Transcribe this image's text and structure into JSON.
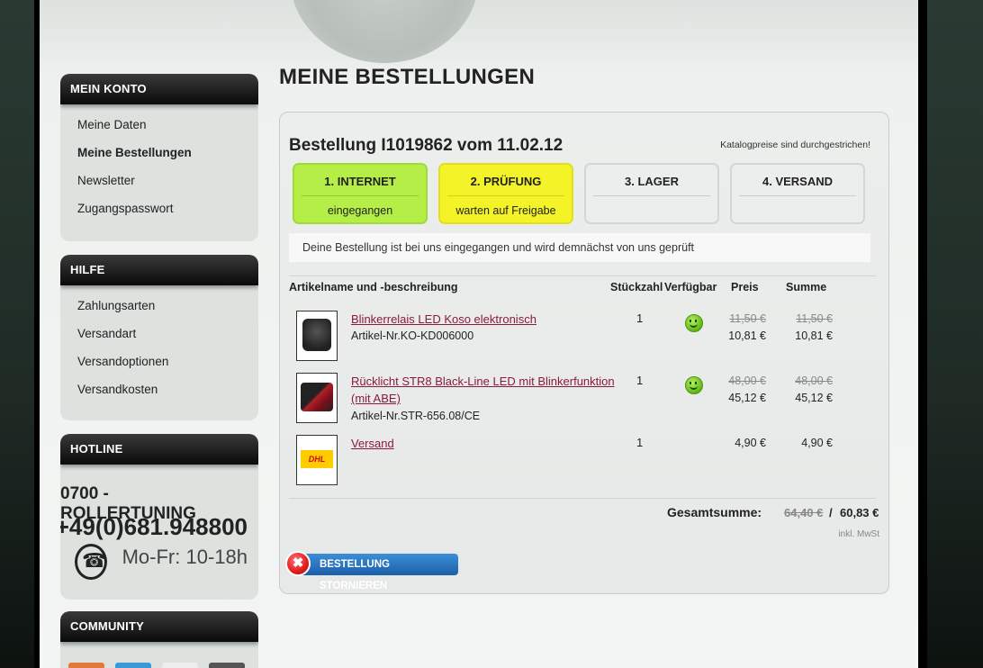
{
  "sidebar": {
    "mein_konto": {
      "title": "MEIN KONTO",
      "items": [
        {
          "label": "Meine Daten",
          "active": false
        },
        {
          "label": "Meine Bestellungen",
          "active": true
        },
        {
          "label": "Newsletter",
          "active": false
        },
        {
          "label": "Zugangspasswort",
          "active": false
        }
      ]
    },
    "hilfe": {
      "title": "HILFE",
      "items": [
        {
          "label": "Zahlungsarten"
        },
        {
          "label": "Versandart"
        },
        {
          "label": "Versandoptionen"
        },
        {
          "label": "Versandkosten"
        }
      ]
    },
    "hotline": {
      "title": "HOTLINE",
      "name": "0700 - ROLLERTUNING",
      "number": "+49(0)681.948800",
      "hours": "Mo-Fr: 10-18h"
    },
    "community": {
      "title": "COMMUNITY"
    }
  },
  "main": {
    "title": "MEINE BESTELLUNGEN",
    "order_title": "Bestellung I1019862 vom 11.02.12",
    "catalog_note": "Katalogpreise sind durchgestrichen!",
    "steps": [
      {
        "title": "1. INTERNET",
        "status": "eingegangen",
        "color": "#b6ee48"
      },
      {
        "title": "2. PRÜFUNG",
        "status": "warten auf Freigabe",
        "color": "#f3f328"
      },
      {
        "title": "3. LAGER",
        "status": ""
      },
      {
        "title": "4. VERSAND",
        "status": ""
      }
    ],
    "info_message": "Deine Bestellung ist bei uns eingegangen und wird demnächst von uns geprüft",
    "table": {
      "headers": {
        "article": "Artikelname und -beschreibung",
        "qty": "Stückzahl",
        "available": "Verfügbar",
        "price": "Preis",
        "sum": "Summe"
      },
      "rows": [
        {
          "name": "Blinkerrelais LED Koso elektronisch",
          "article_no": "Artikel-Nr.KO-KD006000",
          "qty": "1",
          "price_old": "11,50 €",
          "price": "10,81 €",
          "sum_old": "11,50 €",
          "sum": "10,81 €"
        },
        {
          "name_line1": "Rücklicht STR8 Black-Line LED mit Blinkerfunktion",
          "name_line2": "(mit ABE)",
          "article_no": "Artikel-Nr.STR-656.08/CE",
          "qty": "1",
          "price_old": "48,00 €",
          "price": "45,12 €",
          "sum_old": "48,00 €",
          "sum": "45,12 €"
        },
        {
          "name": "Versand",
          "logo_text": "DHL",
          "qty": "1",
          "price": "4,90 €",
          "sum": "4,90 €"
        }
      ]
    },
    "total": {
      "label": "Gesamtsumme:",
      "old": "64,40 €",
      "separator": "/",
      "new": "60,83 €",
      "tax_note": "inkl. MwSt"
    },
    "cancel_button": {
      "label": "BESTELLUNG STORNIEREN",
      "icon": "✖"
    }
  },
  "colors": {
    "link": "#8b1a3a",
    "step_done": "#b6ee48",
    "step_pending": "#f3f328",
    "button_blue": "#1b5fa8"
  }
}
